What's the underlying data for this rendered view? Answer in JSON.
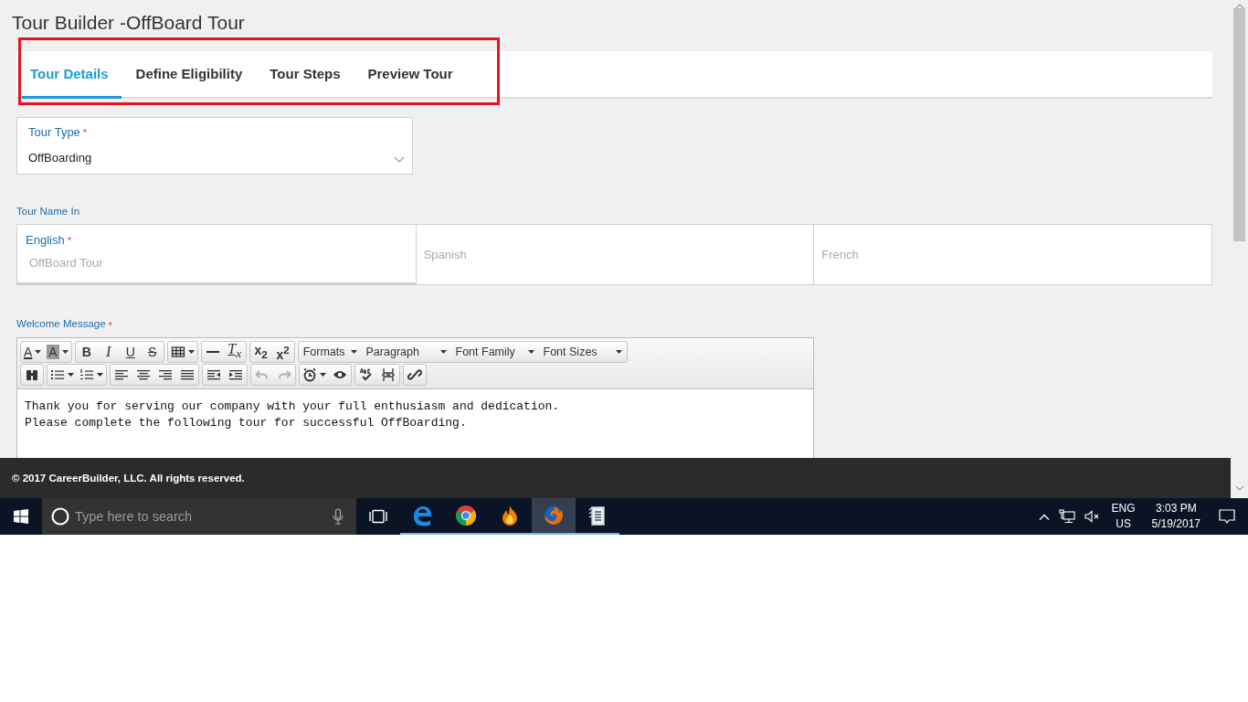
{
  "page_title": "Tour Builder -OffBoard Tour",
  "tabs": [
    {
      "label": "Tour Details",
      "selected": true
    },
    {
      "label": "Define Eligibility",
      "selected": false
    },
    {
      "label": "Tour Steps",
      "selected": false
    },
    {
      "label": "Preview Tour",
      "selected": false
    }
  ],
  "tour_type": {
    "label": "Tour Type",
    "required_mark": "*",
    "value": "OffBoarding"
  },
  "tour_name": {
    "label": "Tour Name In",
    "fields": [
      {
        "label": "English",
        "required_mark": "*",
        "placeholder": "OffBoard Tour"
      },
      {
        "placeholder": "Spanish"
      },
      {
        "placeholder": "French"
      }
    ]
  },
  "welcome": {
    "label": "Welcome Message",
    "required_mark": "*",
    "toolbar": [
      [
        [
          {
            "kind": "text-color",
            "label": "A",
            "caret": true
          },
          {
            "kind": "bg-color",
            "label": "A",
            "caret": true
          }
        ],
        [
          {
            "kind": "bold",
            "label": "B"
          },
          {
            "kind": "italic",
            "label": "I"
          },
          {
            "kind": "underline",
            "label": "U"
          },
          {
            "kind": "strike",
            "label": "S"
          }
        ],
        [
          {
            "kind": "table",
            "caret": true
          }
        ],
        [
          {
            "kind": "hr"
          },
          {
            "kind": "clear",
            "label": "T$_{x}$"
          }
        ],
        [
          {
            "kind": "sub",
            "label": "x$_{2}$"
          },
          {
            "kind": "sup",
            "label": "x$^{2}$"
          }
        ],
        [
          {
            "kind": "menu",
            "label": "Formats"
          },
          {
            "kind": "menu",
            "label": "Paragraph"
          },
          {
            "kind": "menu",
            "label": "Font Family"
          },
          {
            "kind": "menu",
            "label": "Font Sizes"
          }
        ]
      ],
      [
        [
          {
            "kind": "find"
          }
        ],
        [
          {
            "kind": "bullets",
            "caret": true
          },
          {
            "kind": "numbers",
            "caret": true
          }
        ],
        [
          {
            "kind": "align-left"
          },
          {
            "kind": "align-center"
          },
          {
            "kind": "align-right"
          },
          {
            "kind": "justify"
          }
        ],
        [
          {
            "kind": "outdent"
          },
          {
            "kind": "indent"
          }
        ],
        [
          {
            "kind": "undo",
            "disabled": true
          },
          {
            "kind": "redo",
            "disabled": true
          }
        ],
        [
          {
            "kind": "clock",
            "caret": true
          },
          {
            "kind": "eye"
          }
        ],
        [
          {
            "kind": "spellcheck"
          },
          {
            "kind": "pagebreak"
          }
        ],
        [
          {
            "kind": "link"
          }
        ]
      ]
    ],
    "body": [
      "Thank you for serving our company with your full enthusiasm and dedication.",
      "Please complete the following tour for successful OffBoarding."
    ]
  },
  "footer": "© 2017 CareerBuilder, LLC. All rights reserved.",
  "taskbar": {
    "search_placeholder": "Type here to search",
    "apps": [
      {
        "kind": "edge",
        "selected": false
      },
      {
        "kind": "chrome",
        "selected": false
      },
      {
        "kind": "flame",
        "selected": false
      },
      {
        "kind": "firefox",
        "selected": true
      },
      {
        "kind": "files",
        "selected": false
      }
    ],
    "language": "ENG",
    "region": "US",
    "time": "3:03 PM",
    "date": "5/19/2017"
  }
}
